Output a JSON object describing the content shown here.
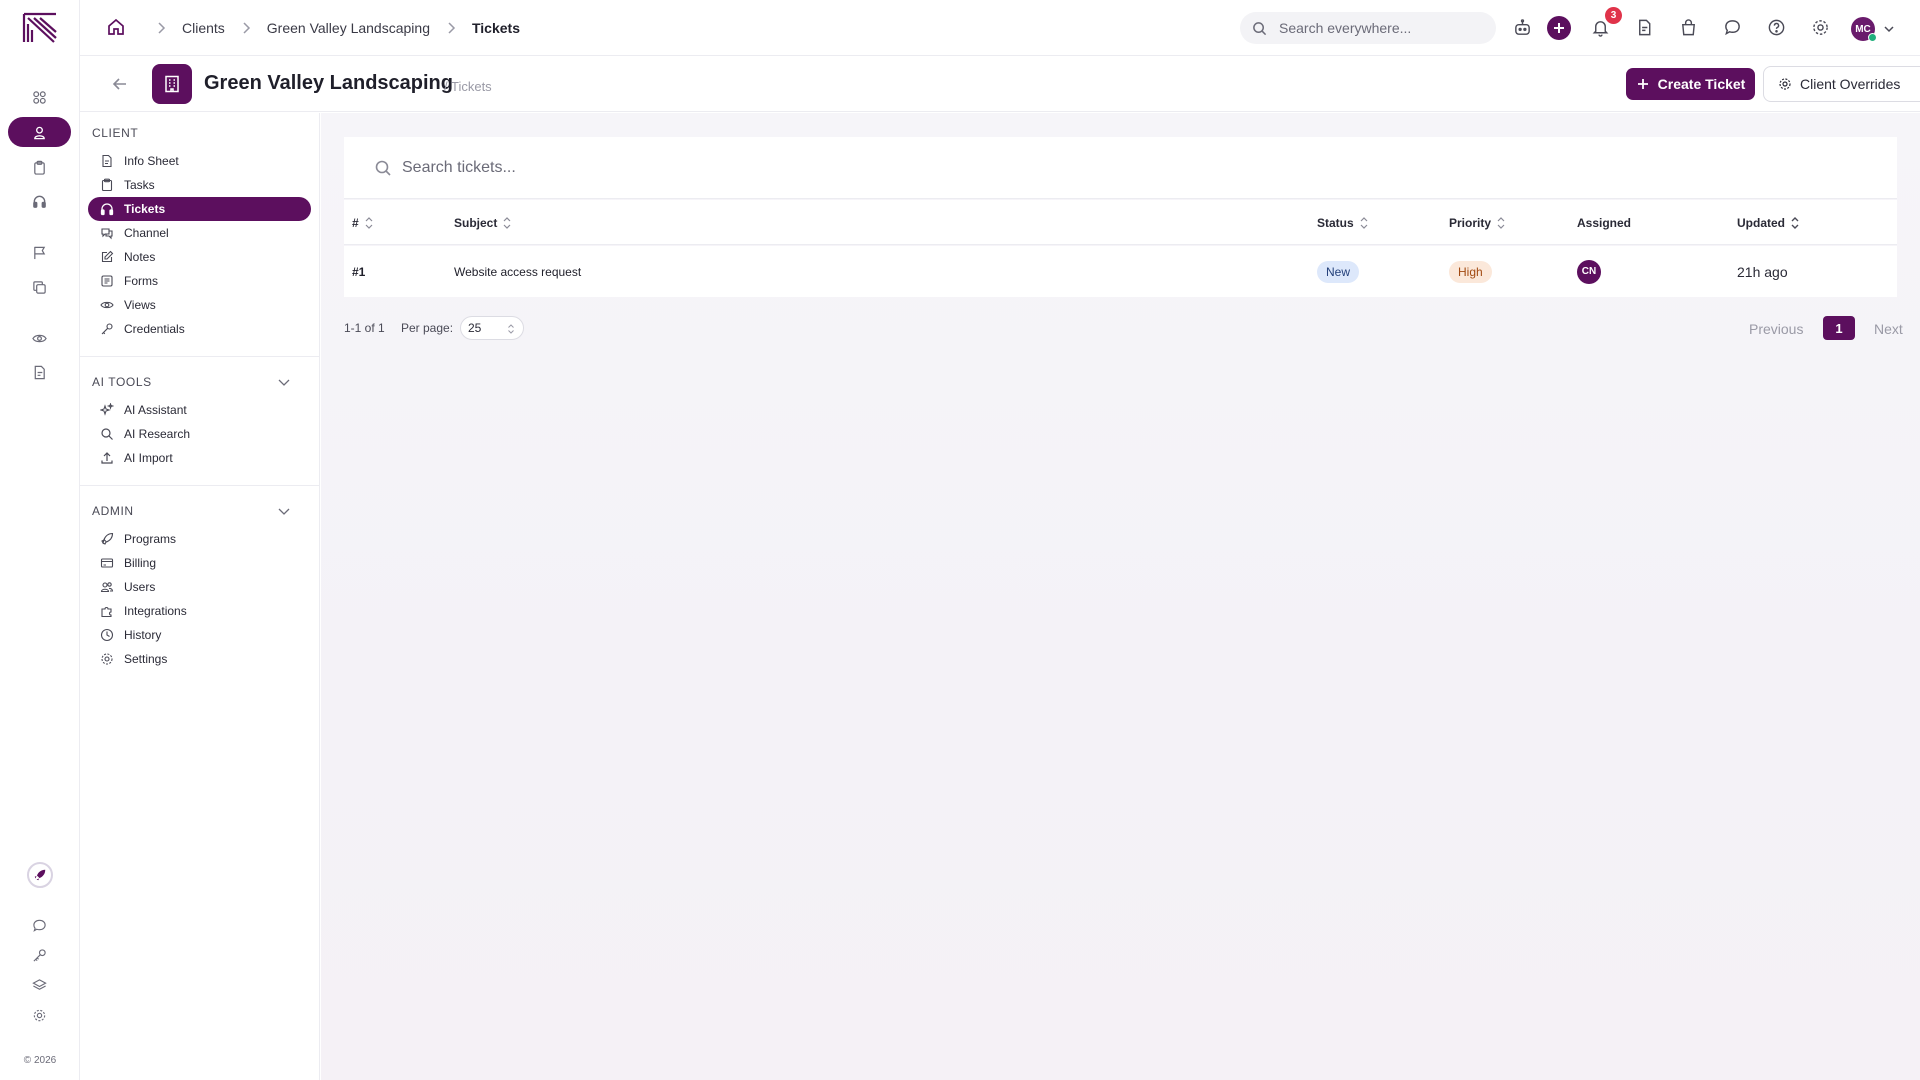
{
  "app": {
    "brand_color": "#5c0f5e",
    "copyright": "© 2026"
  },
  "rail": {
    "items": [
      {
        "name": "dashboard-icon"
      },
      {
        "name": "clients-icon",
        "active": true
      },
      {
        "name": "clipboard-icon"
      },
      {
        "name": "headset-icon"
      },
      {
        "name": "flag-icon"
      },
      {
        "name": "copy-icon"
      },
      {
        "name": "eye-icon"
      },
      {
        "name": "document-icon"
      }
    ],
    "bottom": [
      "rocket-icon",
      "chat-icon",
      "key-icon",
      "layers-icon",
      "gear-icon"
    ]
  },
  "topbar": {
    "breadcrumb": [
      "Clients",
      "Green Valley Landscaping",
      "Tickets"
    ],
    "search_placeholder": "Search everywhere...",
    "notifications_count": "3",
    "user_initials": "MC",
    "icons": [
      "robot-icon",
      "add-icon",
      "bell-icon",
      "file-icon",
      "bag-icon",
      "message-icon",
      "help-icon",
      "settings-icon"
    ]
  },
  "header": {
    "title": "Green Valley Landscaping",
    "subtitle": "/ Tickets",
    "create_button": "Create Ticket",
    "overrides_button": "Client Overrides"
  },
  "sidebar": {
    "client_title": "CLIENT",
    "client_items": [
      {
        "label": "Info Sheet",
        "icon": "file-text-icon"
      },
      {
        "label": "Tasks",
        "icon": "clipboard-icon"
      },
      {
        "label": "Tickets",
        "icon": "headset-icon",
        "active": true
      },
      {
        "label": "Channel",
        "icon": "chat-bubbles-icon"
      },
      {
        "label": "Notes",
        "icon": "edit-icon"
      },
      {
        "label": "Forms",
        "icon": "form-icon"
      },
      {
        "label": "Views",
        "icon": "eye-icon"
      },
      {
        "label": "Credentials",
        "icon": "key-icon"
      }
    ],
    "ai_title": "AI TOOLS",
    "ai_items": [
      {
        "label": "AI Assistant",
        "icon": "sparkles-icon"
      },
      {
        "label": "AI Research",
        "icon": "search-icon"
      },
      {
        "label": "AI Import",
        "icon": "upload-icon"
      }
    ],
    "admin_title": "ADMIN",
    "admin_items": [
      {
        "label": "Programs",
        "icon": "rocket-icon"
      },
      {
        "label": "Billing",
        "icon": "credit-card-icon"
      },
      {
        "label": "Users",
        "icon": "users-icon"
      },
      {
        "label": "Integrations",
        "icon": "puzzle-icon"
      },
      {
        "label": "History",
        "icon": "clock-icon"
      },
      {
        "label": "Settings",
        "icon": "gear-icon"
      }
    ]
  },
  "tickets": {
    "search_placeholder": "Search tickets...",
    "columns": [
      "#",
      "Subject",
      "Status",
      "Priority",
      "Assigned",
      "Updated"
    ],
    "rows": [
      {
        "id": "#1",
        "subject": "Website access request",
        "status": "New",
        "priority": "High",
        "assigned_initials": "CN",
        "updated": "21h ago"
      }
    ],
    "range": "1-1 of 1",
    "per_page_label": "Per page:",
    "per_page_value": "25",
    "previous": "Previous",
    "current_page": "1",
    "next": "Next"
  }
}
